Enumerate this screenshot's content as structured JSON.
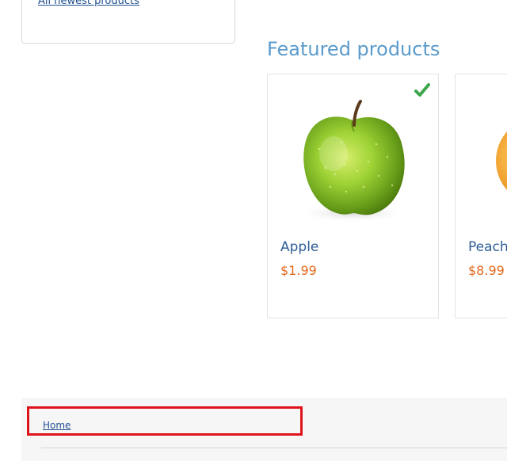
{
  "sidebar": {
    "newest_link_label": "All newest products"
  },
  "featured": {
    "title": "Featured products",
    "products": [
      {
        "name": "Apple",
        "price": "$1.99",
        "selected": true,
        "image_icon": "green-apple-image",
        "selected_icon": "checkmark-icon"
      },
      {
        "name": "Peach",
        "price": "$8.99",
        "selected": false,
        "image_icon": "peach-image"
      }
    ]
  },
  "breadcrumb": {
    "home_label": "Home"
  },
  "colors": {
    "heading": "#5b9bcb",
    "product_name": "#2d5d97",
    "price": "#e46a1f",
    "check": "#3ca64a",
    "highlight_border": "#e0131b",
    "footer_bg": "#f6f6f6"
  }
}
